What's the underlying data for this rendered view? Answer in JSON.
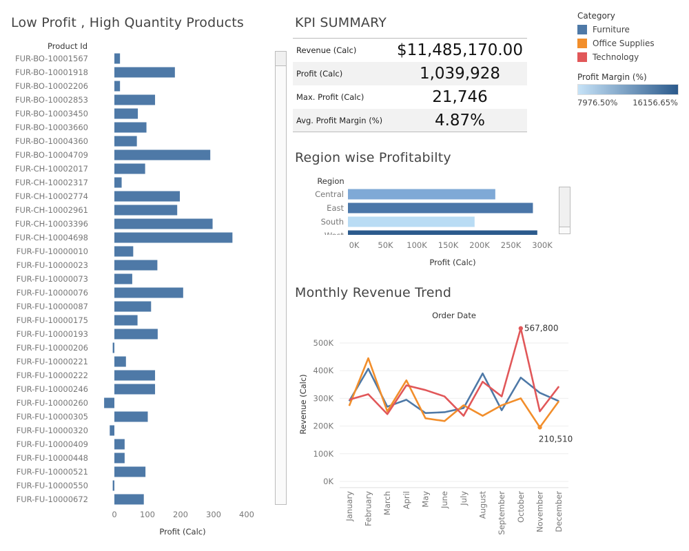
{
  "low_profit_title": "Low Profit , High Quantity Products",
  "kpi_title": "KPI SUMMARY",
  "region_title": "Region wise Profitabilty",
  "monthly_title": "Monthly Revenue Trend",
  "kpis": [
    {
      "label": "Revenue (Calc)",
      "value": "$11,485,170.00"
    },
    {
      "label": "Profit (Calc)",
      "value": "1,039,928"
    },
    {
      "label": "Max. Profit (Calc)",
      "value": "21,746"
    },
    {
      "label": "Avg. Profit Margin (%)",
      "value": "4.87%"
    }
  ],
  "legend": {
    "category_title": "Category",
    "categories": [
      {
        "name": "Furniture",
        "color": "#4e79a7"
      },
      {
        "name": "Office Supplies",
        "color": "#f28e2b"
      },
      {
        "name": "Technology",
        "color": "#e15759"
      }
    ],
    "margin_title": "Profit Margin (%)",
    "margin_min": "7976.50%",
    "margin_max": "16156.65%",
    "gradient_colors": [
      "#c6e2f7",
      "#2b5a8c"
    ]
  },
  "chart_data": [
    {
      "type": "bar",
      "orientation": "horizontal",
      "title": "Low Profit , High Quantity Products",
      "ylabel": "Product Id",
      "xlabel": "Profit (Calc)",
      "xlim": [
        -30,
        400
      ],
      "xticks": [
        0,
        100,
        200,
        300,
        400
      ],
      "color": "#4e79a7",
      "categories": [
        "FUR-BO-10001567",
        "FUR-BO-10001918",
        "FUR-BO-10002206",
        "FUR-BO-10002853",
        "FUR-BO-10003450",
        "FUR-BO-10003660",
        "FUR-BO-10004360",
        "FUR-BO-10004709",
        "FUR-CH-10002017",
        "FUR-CH-10002317",
        "FUR-CH-10002774",
        "FUR-CH-10002961",
        "FUR-CH-10003396",
        "FUR-CH-10004698",
        "FUR-FU-10000010",
        "FUR-FU-10000023",
        "FUR-FU-10000073",
        "FUR-FU-10000076",
        "FUR-FU-10000087",
        "FUR-FU-10000175",
        "FUR-FU-10000193",
        "FUR-FU-10000206",
        "FUR-FU-10000221",
        "FUR-FU-10000222",
        "FUR-FU-10000246",
        "FUR-FU-10000260",
        "FUR-FU-10000305",
        "FUR-FU-10000320",
        "FUR-FU-10000409",
        "FUR-FU-10000448",
        "FUR-FU-10000521",
        "FUR-FU-10000550",
        "FUR-FU-10000672"
      ],
      "values": [
        17,
        183,
        17,
        123,
        71,
        97,
        68,
        290,
        93,
        22,
        198,
        190,
        297,
        357,
        57,
        130,
        54,
        208,
        111,
        70,
        131,
        -5,
        35,
        123,
        123,
        -31,
        101,
        -14,
        31,
        31,
        94,
        -5,
        89
      ]
    },
    {
      "type": "bar",
      "orientation": "horizontal",
      "title": "Region wise Profitabilty",
      "ylabel": "Region",
      "xlabel": "Profit (Calc)",
      "xlim": [
        0,
        310000
      ],
      "xticks": [
        0,
        50000,
        100000,
        150000,
        200000,
        250000,
        300000
      ],
      "xtick_labels": [
        "0K",
        "50K",
        "100K",
        "150K",
        "200K",
        "250K",
        "300K"
      ],
      "categories": [
        "Central",
        "East",
        "South",
        "West"
      ],
      "values": [
        235000,
        295000,
        202000,
        302000
      ],
      "colors": [
        "#7fa9d6",
        "#4a76a8",
        "#b9dcf4",
        "#2b5a8c"
      ]
    },
    {
      "type": "line",
      "title": "Monthly Revenue Trend",
      "xlabel": "Order Date",
      "ylabel": "Revenue (Calc)",
      "ylim": [
        0,
        580000
      ],
      "yticks": [
        0,
        100000,
        200000,
        300000,
        400000,
        500000
      ],
      "ytick_labels": [
        "0K",
        "100K",
        "200K",
        "300K",
        "400K",
        "500K"
      ],
      "x": [
        "January",
        "February",
        "March",
        "April",
        "May",
        "June",
        "July",
        "August",
        "September",
        "October",
        "November",
        "December"
      ],
      "series": [
        {
          "name": "Furniture",
          "color": "#4e79a7",
          "values": [
            305000,
            422000,
            285000,
            310000,
            262000,
            265000,
            280000,
            405000,
            272000,
            390000,
            335000,
            305000
          ]
        },
        {
          "name": "Office Supplies",
          "color": "#f28e2b",
          "values": [
            288000,
            460000,
            268000,
            380000,
            243000,
            233000,
            290000,
            252000,
            290000,
            315000,
            210510,
            305000
          ]
        },
        {
          "name": "Technology",
          "color": "#e15759",
          "values": [
            310000,
            330000,
            258000,
            362000,
            345000,
            322000,
            252000,
            375000,
            322000,
            567800,
            268000,
            358000
          ]
        }
      ],
      "annotations": [
        {
          "text": "567,800",
          "series": "Technology",
          "index": 9
        },
        {
          "text": "210,510",
          "series": "Office Supplies",
          "index": 10
        }
      ]
    }
  ]
}
